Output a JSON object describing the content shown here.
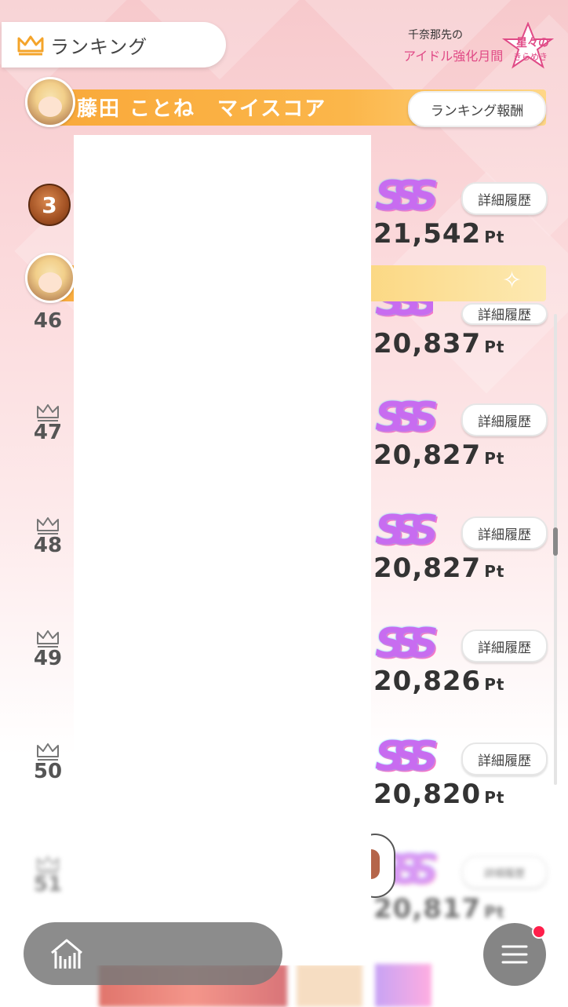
{
  "header": {
    "title": "ランキング",
    "event_logo_line1": "千奈那先の",
    "event_logo_line2": "アイドル強化月間",
    "event_logo_star_line1": "星々の",
    "event_logo_star_line2": "きらめき"
  },
  "myscore": {
    "label": "藤田 ことね　マイスコア",
    "reward_button": "ランキング報酬"
  },
  "top_row": {
    "rank": "3",
    "score": "21,542",
    "unit": "Pt",
    "badge": "SSS",
    "detail_button": "詳細履歴"
  },
  "rows": [
    {
      "rank": "46",
      "score": "20,837",
      "unit": "Pt",
      "badge": "SSS",
      "detail_button": "詳細履歴"
    },
    {
      "rank": "47",
      "score": "20,827",
      "unit": "Pt",
      "badge": "SSS",
      "detail_button": "詳細履歴"
    },
    {
      "rank": "48",
      "score": "20,827",
      "unit": "Pt",
      "badge": "SSS",
      "detail_button": "詳細履歴"
    },
    {
      "rank": "49",
      "score": "20,826",
      "unit": "Pt",
      "badge": "SSS",
      "detail_button": "詳細履歴"
    },
    {
      "rank": "50",
      "score": "20,820",
      "unit": "Pt",
      "badge": "SSS",
      "detail_button": "詳細履歴"
    },
    {
      "rank": "51",
      "score": "20,817",
      "unit": "Pt",
      "badge": "SSS",
      "detail_button": "詳細履歴"
    }
  ],
  "colors": {
    "accent_orange": "#f9a93a",
    "bg_pink": "#f7c9cc",
    "notification_red": "#ff1f4b"
  },
  "icons": {
    "crown": "crown-icon",
    "home": "home-icon",
    "menu": "hamburger-menu-icon"
  }
}
